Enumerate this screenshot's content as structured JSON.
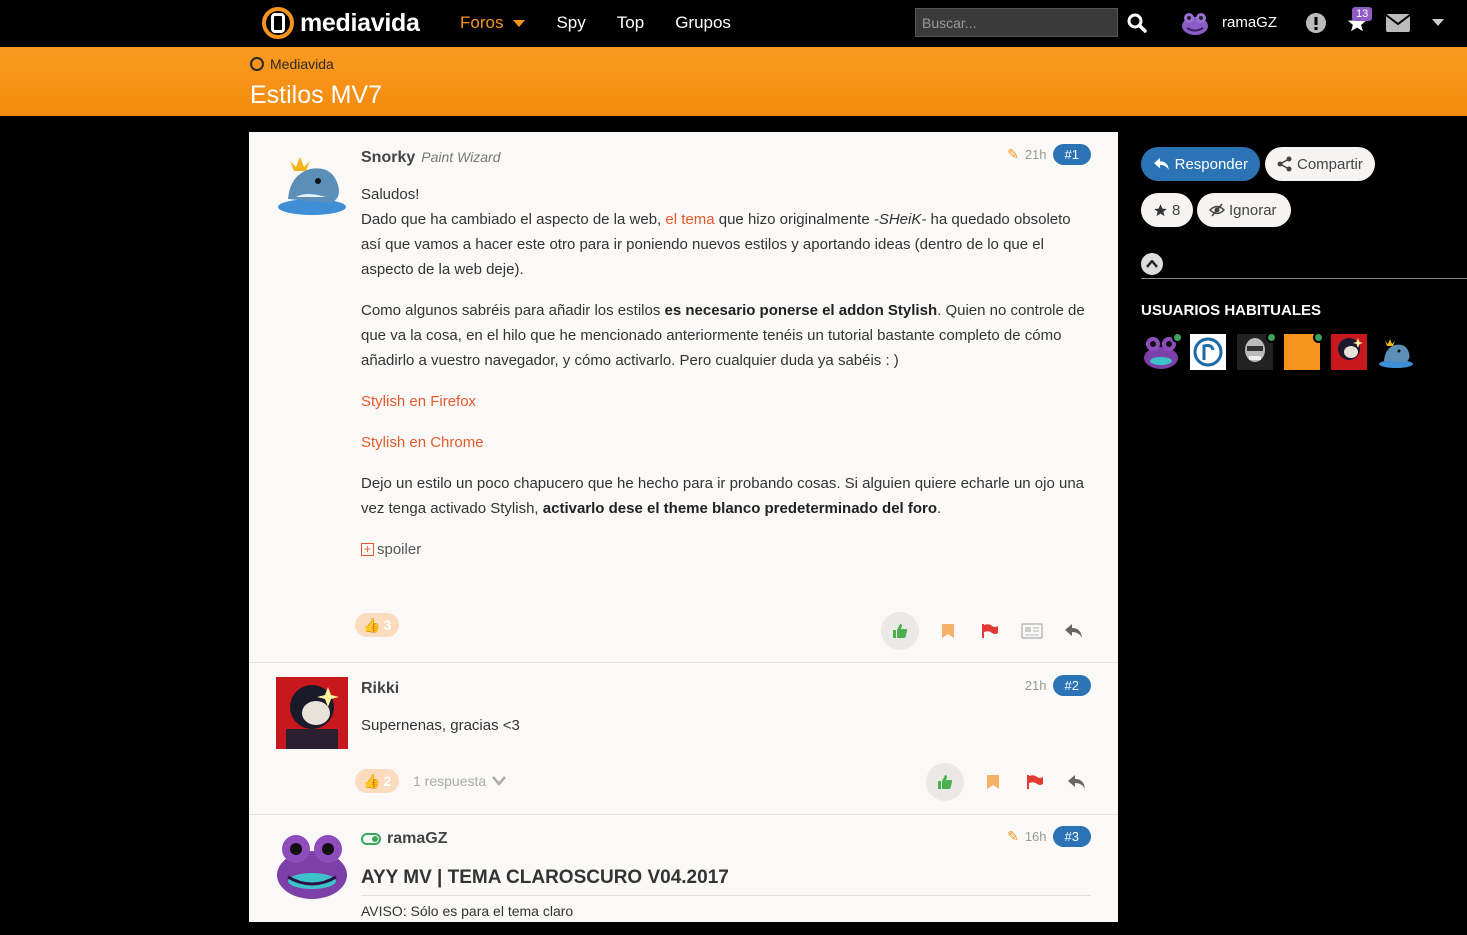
{
  "topbar": {
    "logo_text": "mediavida",
    "nav": [
      "Foros",
      "Spy",
      "Top",
      "Grupos"
    ],
    "search_placeholder": "Buscar...",
    "username": "ramaGZ",
    "favorites_count": "13"
  },
  "header": {
    "breadcrumb": "Mediavida",
    "title": "Estilos MV7"
  },
  "posts": [
    {
      "author": "Snorky",
      "author_title": "Paint Wizard",
      "time": "21h",
      "number": "#1",
      "likes": "3",
      "body": {
        "p1_line1": "Saludos!",
        "p1_a": "Dado que ha cambiado el aspecto de la web, ",
        "p1_link": "el tema",
        "p1_b": " que hizo originalmente ",
        "p1_em": "-SHeiK-",
        "p1_c": " ha quedado obsoleto así que vamos a hacer este otro para ir poniendo nuevos estilos y aportando ideas (dentro de lo que el aspecto de la web deje).",
        "p2_a": "Como algunos sabréis para añadir los estilos ",
        "p2_bold": "es necesario ponerse el addon Stylish",
        "p2_b": ". Quien no controle de que va la cosa, en el hilo que he mencionado anteriormente tenéis un tutorial bastante completo de cómo añadirlo a vuestro navegador, y cómo activarlo. Pero cualquier duda ya sabéis : )",
        "link_firefox": "Stylish en Firefox",
        "link_chrome": "Stylish en Chrome",
        "p3_a": "Dejo un estilo un poco chapucero que he hecho para ir probando cosas. Si alguien quiere echarle un ojo una vez tenga activado Stylish, ",
        "p3_bold": "activarlo dese el theme blanco predeterminado del foro",
        "p3_b": ".",
        "spoiler": "spoiler"
      }
    },
    {
      "author": "Rikki",
      "time": "21h",
      "number": "#2",
      "body": "Supernenas, gracias <3",
      "likes": "2",
      "replies": "1 respuesta"
    },
    {
      "author": "ramaGZ",
      "time": "16h",
      "number": "#3",
      "title": "AYY MV | TEMA CLAROSCURO V04.2017",
      "body_partial": "AVISO: Sólo es para el tema claro"
    }
  ],
  "sidebar": {
    "reply_label": "Responder",
    "share_label": "Compartir",
    "fav_count": "8",
    "ignore_label": "Ignorar",
    "regulars_title": "USUARIOS HABITUALES"
  },
  "colors": {
    "accent": "#f7941d",
    "link": "#e55a2b",
    "badge_blue": "#2b73b5",
    "online": "#3ba55d"
  }
}
